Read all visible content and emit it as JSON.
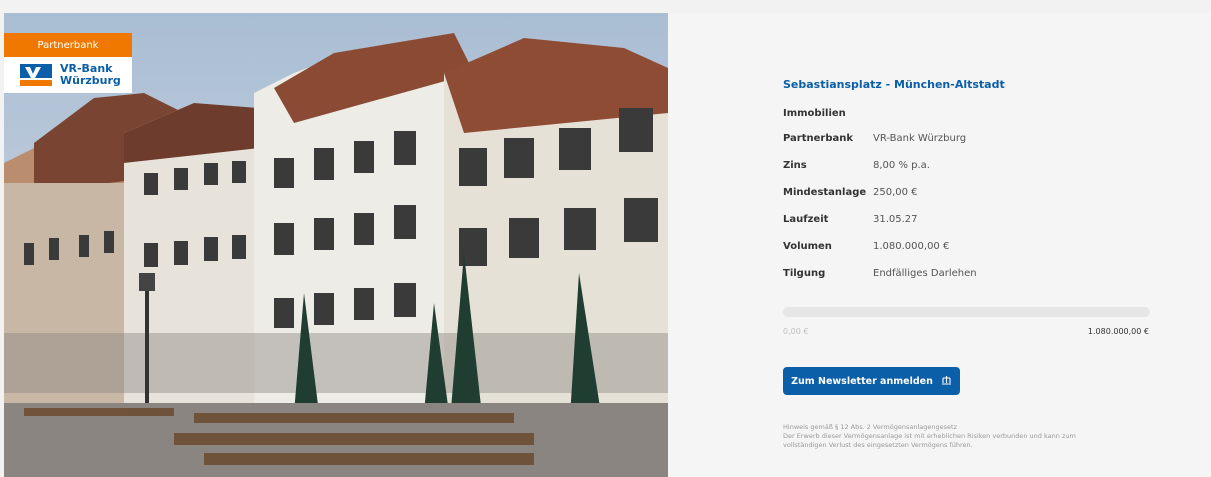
{
  "badge": {
    "label": "Partnerbank",
    "bank_line1": "VR-Bank",
    "bank_line2": "Würzburg"
  },
  "project": {
    "title": "Sebastiansplatz - München-Altstadt",
    "category": "Immobilien",
    "fields": [
      {
        "label": "Partnerbank",
        "value": "VR-Bank Würzburg"
      },
      {
        "label": "Zins",
        "value": "8,00 % p.a."
      },
      {
        "label": "Mindestanlage",
        "value": "250,00 €"
      },
      {
        "label": "Laufzeit",
        "value": "31.05.27"
      },
      {
        "label": "Volumen",
        "value": "1.080.000,00 €"
      },
      {
        "label": "Tilgung",
        "value": "Endfälliges Darlehen"
      }
    ]
  },
  "progress": {
    "min_label": "0,00 €",
    "max_label": "1.080.000,00 €",
    "fraction": 0
  },
  "newsletter": {
    "label": "Zum Newsletter anmelden"
  },
  "disclaimer": {
    "line1": "Hinweis gemäß § 12 Abs. 2 Vermögensanlagengesetz",
    "line2": "Der Erwerb dieser Vermögensanlage ist mit erheblichen Risiken verbunden und kann zum",
    "line3": "vollständigen Verlust des eingesetzten Vermögens führen."
  },
  "colors": {
    "accent": "#0b5ea8",
    "badge": "#f07800"
  }
}
